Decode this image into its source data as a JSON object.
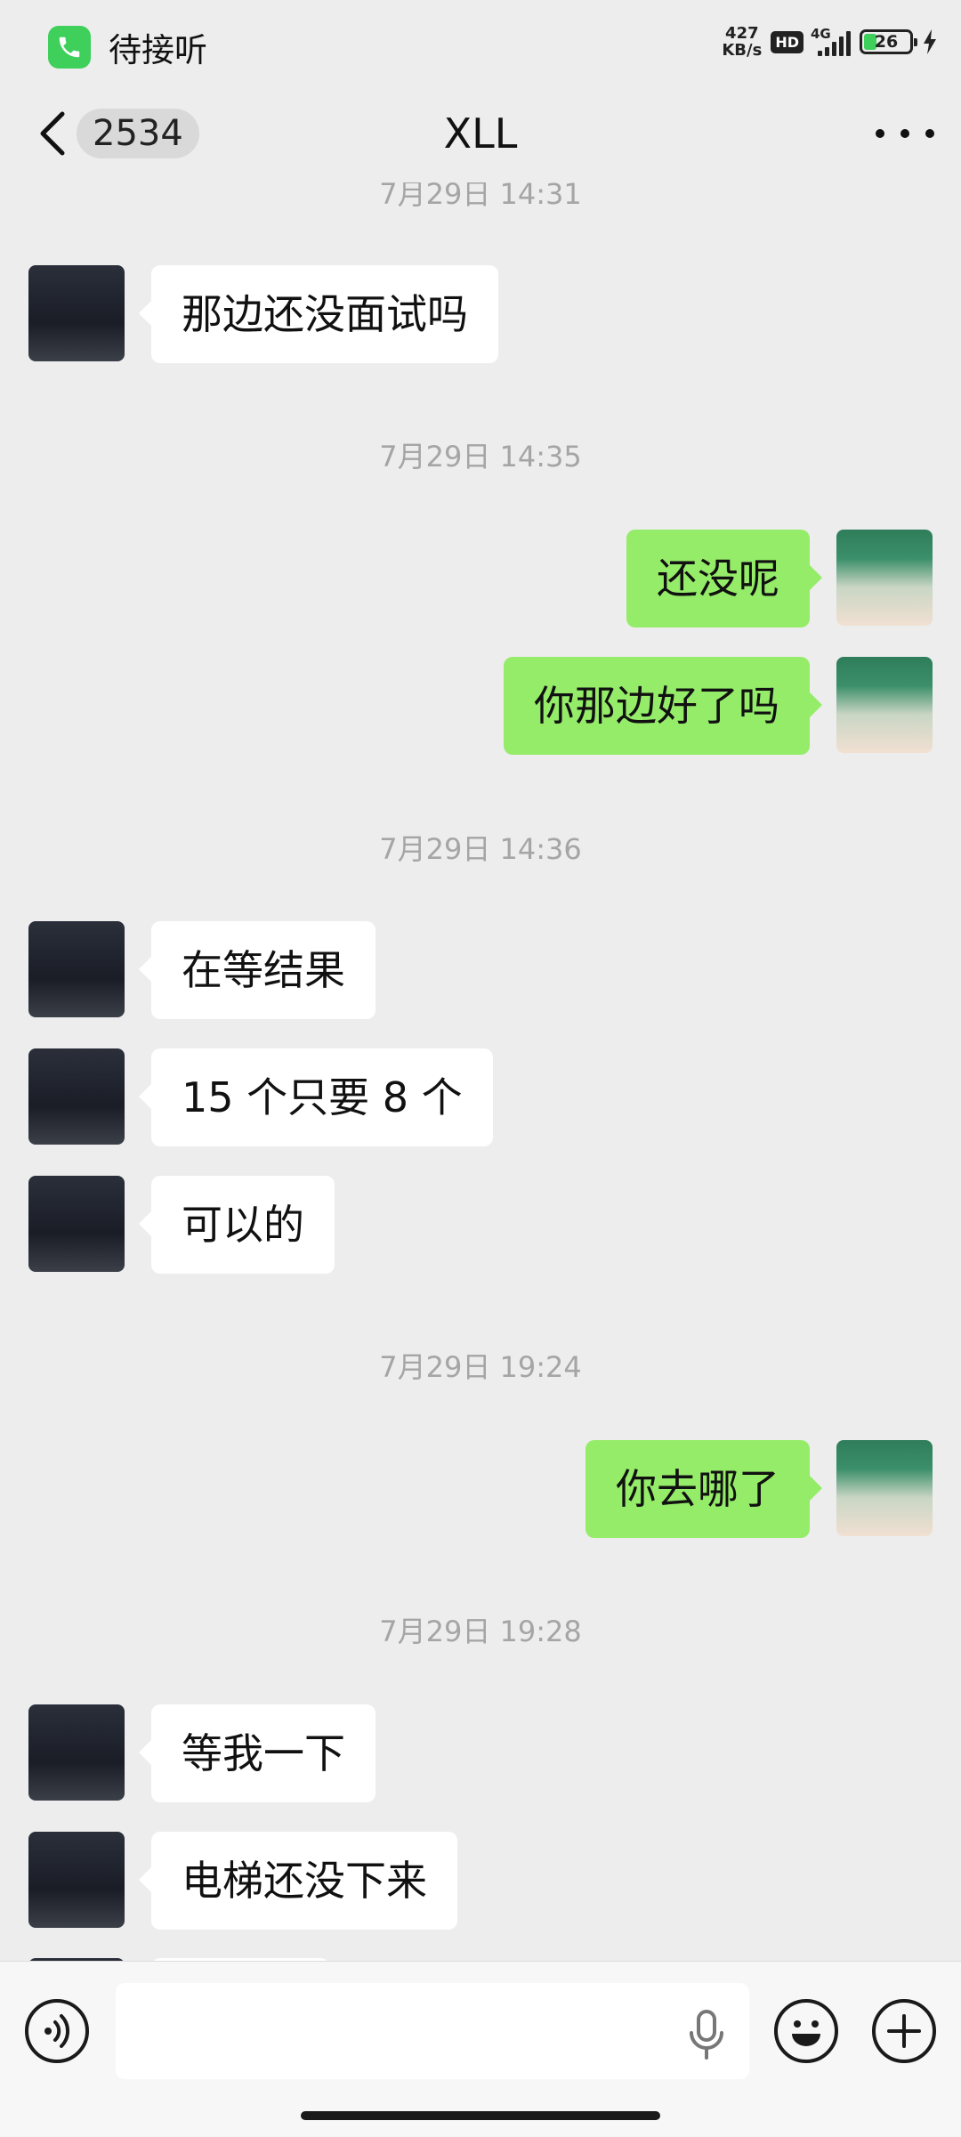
{
  "status_bar": {
    "call_label": "待接听",
    "net_speed_value": "427",
    "net_speed_unit": "KB/s",
    "hd_label": "HD",
    "network_type": "4G",
    "battery_level": "26",
    "battery_color": "#3fcf5b"
  },
  "nav": {
    "unread_count": "2534",
    "title": "XLL"
  },
  "messages": [
    {
      "type": "timestamp",
      "text": "7月29日 14:31"
    },
    {
      "type": "message",
      "side": "left",
      "text": "那边还没面试吗"
    },
    {
      "type": "timestamp",
      "text": "7月29日 14:35"
    },
    {
      "type": "message",
      "side": "right",
      "text": "还没呢"
    },
    {
      "type": "message",
      "side": "right",
      "text": "你那边好了吗"
    },
    {
      "type": "timestamp",
      "text": "7月29日 14:36"
    },
    {
      "type": "message",
      "side": "left",
      "text": "在等结果"
    },
    {
      "type": "message",
      "side": "left",
      "text": "15 个只要 8 个"
    },
    {
      "type": "message",
      "side": "left",
      "text": "可以的"
    },
    {
      "type": "timestamp",
      "text": "7月29日 19:24"
    },
    {
      "type": "message",
      "side": "right",
      "text": "你去哪了"
    },
    {
      "type": "timestamp",
      "text": "7月29日 19:28"
    },
    {
      "type": "message",
      "side": "left",
      "text": "等我一下"
    },
    {
      "type": "message",
      "side": "left",
      "text": "电梯还没下来"
    }
  ],
  "input": {
    "value": "",
    "placeholder": ""
  },
  "colors": {
    "background": "#ededed",
    "sent_bubble": "#95ec69",
    "received_bubble": "#ffffff",
    "timestamp_text": "#a5a5a5"
  },
  "icons": {
    "call": "phone-icon",
    "back": "chevron-left-icon",
    "more": "more-dots-icon",
    "voice": "voice-mode-icon",
    "mic": "microphone-icon",
    "emoji": "emoji-icon",
    "plus": "plus-icon"
  }
}
